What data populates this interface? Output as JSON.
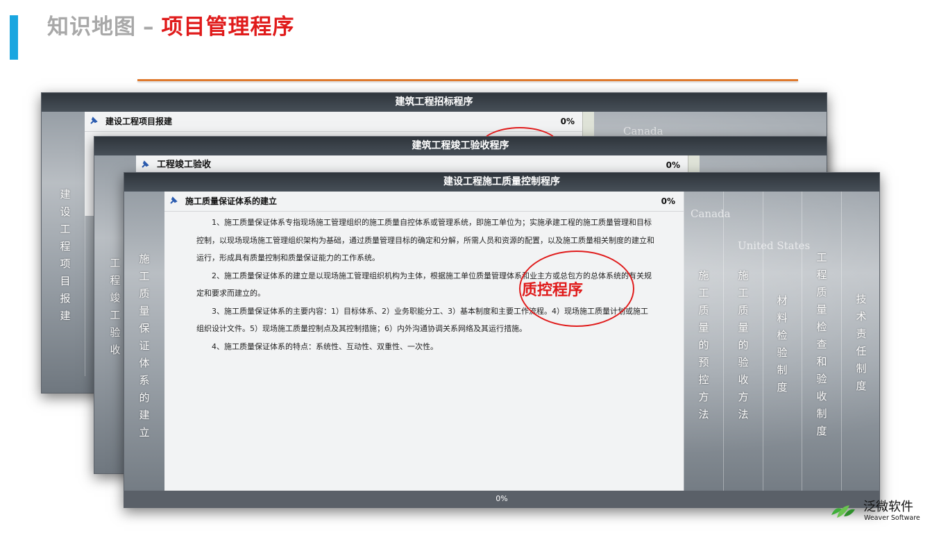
{
  "header": {
    "title_gray": "知识地图",
    "separator": "–",
    "title_red": "项目管理程序"
  },
  "windows": [
    {
      "title": "建筑工程招标程序",
      "item_title": "建设工程项目报建",
      "progress": "0%",
      "left_column": "建设工程项目报建",
      "map_label": "Canada"
    },
    {
      "title": "建筑工程竣工验收程序",
      "item_title": "工程竣工验收",
      "progress": "0%",
      "left_column": "工程竣工验收"
    },
    {
      "title": "建设工程施工质量控制程序",
      "item_title": "施工质量保证体系的建立",
      "progress": "0%",
      "footer_progress": "0%",
      "left_column": "施工质量保证体系的建立",
      "right_columns": [
        "施工质量的预控方法",
        "施工质量的验收方法",
        "材料检验制度",
        "工程质量检查和验收制度",
        "技术责任制度"
      ],
      "map_labels": [
        "Canada",
        "United States"
      ],
      "paragraphs": [
        "1、施工质量保证体系专指现场施工管理组织的施工质量自控体系或管理系统，即施工单位为；实施承建工程的施工质量管理和目标控制，以现场现场施工管理组织架构为基础，通过质量管理目标的确定和分解，所需人员和资源的配置，以及施工质量相关制度的建立和运行，形成具有质量控制和质量保证能力的工作系统。",
        "2、施工质量保证体系的建立是以现场施工管理组织机构为主体，根据施工单位质量管理体系和业主方或总包方的总体系统的有关规定和要求而建立的。",
        "3、施工质量保证体系的主要内容：1）目标体系、2）业务职能分工、3）基本制度和主要工作流程。4）现场施工质量计划或施工组织设计文件。5）现场施工质量控制点及其控制措施；6）内外沟通协调关系网络及其运行措施。",
        "4、施工质量保证体系的特点：系统性、互动性、双重性、一次性。"
      ]
    }
  ],
  "annotation": {
    "text": "质控程序",
    "color": "#e01b1b"
  },
  "brand": {
    "name_cn": "泛微软件",
    "name_en": "Weaver Software",
    "logo_icon": "weaver-leaf-icon"
  },
  "colors": {
    "accent_blue": "#1aa6e0",
    "title_red": "#e01b1b",
    "rule_orange": "#e07a2e"
  }
}
